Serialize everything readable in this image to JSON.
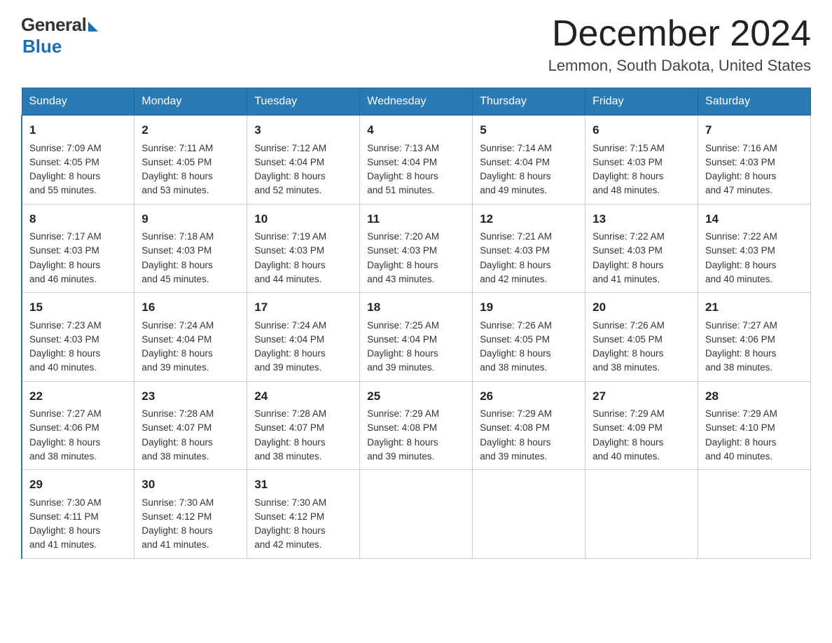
{
  "header": {
    "logo_general": "General",
    "logo_blue": "Blue",
    "title": "December 2024",
    "subtitle": "Lemmon, South Dakota, United States"
  },
  "days_of_week": [
    "Sunday",
    "Monday",
    "Tuesday",
    "Wednesday",
    "Thursday",
    "Friday",
    "Saturday"
  ],
  "weeks": [
    [
      {
        "day": "1",
        "sunrise": "7:09 AM",
        "sunset": "4:05 PM",
        "daylight": "8 hours and 55 minutes."
      },
      {
        "day": "2",
        "sunrise": "7:11 AM",
        "sunset": "4:05 PM",
        "daylight": "8 hours and 53 minutes."
      },
      {
        "day": "3",
        "sunrise": "7:12 AM",
        "sunset": "4:04 PM",
        "daylight": "8 hours and 52 minutes."
      },
      {
        "day": "4",
        "sunrise": "7:13 AM",
        "sunset": "4:04 PM",
        "daylight": "8 hours and 51 minutes."
      },
      {
        "day": "5",
        "sunrise": "7:14 AM",
        "sunset": "4:04 PM",
        "daylight": "8 hours and 49 minutes."
      },
      {
        "day": "6",
        "sunrise": "7:15 AM",
        "sunset": "4:03 PM",
        "daylight": "8 hours and 48 minutes."
      },
      {
        "day": "7",
        "sunrise": "7:16 AM",
        "sunset": "4:03 PM",
        "daylight": "8 hours and 47 minutes."
      }
    ],
    [
      {
        "day": "8",
        "sunrise": "7:17 AM",
        "sunset": "4:03 PM",
        "daylight": "8 hours and 46 minutes."
      },
      {
        "day": "9",
        "sunrise": "7:18 AM",
        "sunset": "4:03 PM",
        "daylight": "8 hours and 45 minutes."
      },
      {
        "day": "10",
        "sunrise": "7:19 AM",
        "sunset": "4:03 PM",
        "daylight": "8 hours and 44 minutes."
      },
      {
        "day": "11",
        "sunrise": "7:20 AM",
        "sunset": "4:03 PM",
        "daylight": "8 hours and 43 minutes."
      },
      {
        "day": "12",
        "sunrise": "7:21 AM",
        "sunset": "4:03 PM",
        "daylight": "8 hours and 42 minutes."
      },
      {
        "day": "13",
        "sunrise": "7:22 AM",
        "sunset": "4:03 PM",
        "daylight": "8 hours and 41 minutes."
      },
      {
        "day": "14",
        "sunrise": "7:22 AM",
        "sunset": "4:03 PM",
        "daylight": "8 hours and 40 minutes."
      }
    ],
    [
      {
        "day": "15",
        "sunrise": "7:23 AM",
        "sunset": "4:03 PM",
        "daylight": "8 hours and 40 minutes."
      },
      {
        "day": "16",
        "sunrise": "7:24 AM",
        "sunset": "4:04 PM",
        "daylight": "8 hours and 39 minutes."
      },
      {
        "day": "17",
        "sunrise": "7:24 AM",
        "sunset": "4:04 PM",
        "daylight": "8 hours and 39 minutes."
      },
      {
        "day": "18",
        "sunrise": "7:25 AM",
        "sunset": "4:04 PM",
        "daylight": "8 hours and 39 minutes."
      },
      {
        "day": "19",
        "sunrise": "7:26 AM",
        "sunset": "4:05 PM",
        "daylight": "8 hours and 38 minutes."
      },
      {
        "day": "20",
        "sunrise": "7:26 AM",
        "sunset": "4:05 PM",
        "daylight": "8 hours and 38 minutes."
      },
      {
        "day": "21",
        "sunrise": "7:27 AM",
        "sunset": "4:06 PM",
        "daylight": "8 hours and 38 minutes."
      }
    ],
    [
      {
        "day": "22",
        "sunrise": "7:27 AM",
        "sunset": "4:06 PM",
        "daylight": "8 hours and 38 minutes."
      },
      {
        "day": "23",
        "sunrise": "7:28 AM",
        "sunset": "4:07 PM",
        "daylight": "8 hours and 38 minutes."
      },
      {
        "day": "24",
        "sunrise": "7:28 AM",
        "sunset": "4:07 PM",
        "daylight": "8 hours and 38 minutes."
      },
      {
        "day": "25",
        "sunrise": "7:29 AM",
        "sunset": "4:08 PM",
        "daylight": "8 hours and 39 minutes."
      },
      {
        "day": "26",
        "sunrise": "7:29 AM",
        "sunset": "4:08 PM",
        "daylight": "8 hours and 39 minutes."
      },
      {
        "day": "27",
        "sunrise": "7:29 AM",
        "sunset": "4:09 PM",
        "daylight": "8 hours and 40 minutes."
      },
      {
        "day": "28",
        "sunrise": "7:29 AM",
        "sunset": "4:10 PM",
        "daylight": "8 hours and 40 minutes."
      }
    ],
    [
      {
        "day": "29",
        "sunrise": "7:30 AM",
        "sunset": "4:11 PM",
        "daylight": "8 hours and 41 minutes."
      },
      {
        "day": "30",
        "sunrise": "7:30 AM",
        "sunset": "4:12 PM",
        "daylight": "8 hours and 41 minutes."
      },
      {
        "day": "31",
        "sunrise": "7:30 AM",
        "sunset": "4:12 PM",
        "daylight": "8 hours and 42 minutes."
      },
      null,
      null,
      null,
      null
    ]
  ],
  "labels": {
    "sunrise": "Sunrise:",
    "sunset": "Sunset:",
    "daylight": "Daylight:"
  }
}
